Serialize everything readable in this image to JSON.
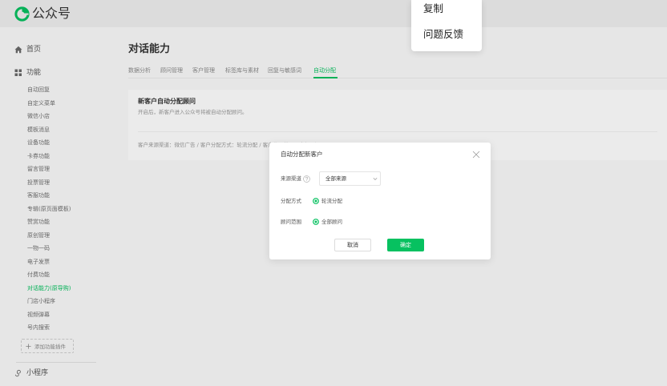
{
  "colors": {
    "accent": "#07c160"
  },
  "brand": {
    "name": "公众号",
    "icon": "wechat-mp-logo-icon"
  },
  "context_menu": {
    "items": [
      "复制",
      "问题反馈"
    ]
  },
  "sidebar": {
    "home": {
      "label": "首页",
      "icon": "home-icon"
    },
    "features": {
      "label": "功能",
      "icon": "grid-icon"
    },
    "feature_items": [
      {
        "label": "自动回复"
      },
      {
        "label": "自定义菜单"
      },
      {
        "label": "微信小店"
      },
      {
        "label": "模板消息"
      },
      {
        "label": "设备功能"
      },
      {
        "label": "卡券功能"
      },
      {
        "label": "留言管理"
      },
      {
        "label": "投票管理"
      },
      {
        "label": "客服功能"
      },
      {
        "label": "专辑(原页面模板)"
      },
      {
        "label": "赞赏功能"
      },
      {
        "label": "原创管理"
      },
      {
        "label": "一物一码"
      },
      {
        "label": "电子发票"
      },
      {
        "label": "付费功能"
      },
      {
        "label": "对话能力(原导购)",
        "active": true
      },
      {
        "label": "门店小程序"
      },
      {
        "label": "视频弹幕"
      },
      {
        "label": "号内搜索"
      }
    ],
    "add_plugin": {
      "label": "添加功能插件",
      "icon": "plus-icon"
    },
    "miniprogram": {
      "label": "小程序",
      "icon": "miniprogram-icon"
    }
  },
  "main": {
    "title": "对话能力",
    "tabs": [
      {
        "label": "数据分析"
      },
      {
        "label": "顾问管理"
      },
      {
        "label": "客户管理"
      },
      {
        "label": "标签库与素材"
      },
      {
        "label": "回复与敏感词"
      },
      {
        "label": "自动分配",
        "active": true
      }
    ],
    "card": {
      "title": "新客户自动分配顾问",
      "description": "开启后，新客户进入公众号将被自动分配顾问。",
      "summary": "客户来源渠道：微信广告 / 客户分配方式：轮流分配 / 客户分配范围：全部顾问"
    }
  },
  "modal": {
    "title": "自动分配新客户",
    "close_icon": "close-icon",
    "source": {
      "label": "来源渠道",
      "help_icon": "question-circle-icon",
      "value": "全部来源"
    },
    "method": {
      "label": "分配方式",
      "option": "轮流分配",
      "checked": true
    },
    "scope": {
      "label": "顾问范围",
      "option": "全部顾问",
      "checked": true
    },
    "cancel_label": "取消",
    "confirm_label": "确定"
  }
}
